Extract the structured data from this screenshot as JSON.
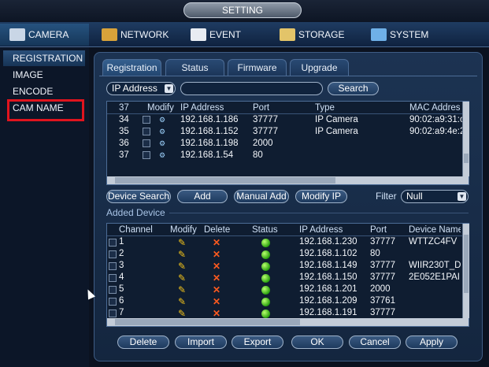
{
  "title": "SETTING",
  "main_tabs": [
    {
      "label": "CAMERA",
      "icon": "camera-icon"
    },
    {
      "label": "NETWORK",
      "icon": "network-icon"
    },
    {
      "label": "EVENT",
      "icon": "event-icon"
    },
    {
      "label": "STORAGE",
      "icon": "storage-icon"
    },
    {
      "label": "SYSTEM",
      "icon": "system-icon"
    }
  ],
  "left_menu": [
    {
      "label": "REGISTRATION",
      "active": true
    },
    {
      "label": "IMAGE"
    },
    {
      "label": "ENCODE"
    },
    {
      "label": "CAM NAME",
      "highlighted": true
    }
  ],
  "sub_tabs": [
    "Registration",
    "Status",
    "Firmware",
    "Upgrade"
  ],
  "search": {
    "type_value": "IP Address",
    "input_value": "",
    "button": "Search"
  },
  "found_table": {
    "headers": {
      "count": "37",
      "modify": "Modify",
      "ip": "IP Address",
      "port": "Port",
      "type": "Type",
      "mac": "MAC Addres"
    },
    "rows": [
      {
        "num": "34",
        "ip": "192.168.1.186",
        "port": "37777",
        "type": "IP Camera",
        "mac": "90:02:a9:31:c"
      },
      {
        "num": "35",
        "ip": "192.168.1.152",
        "port": "37777",
        "type": "IP Camera",
        "mac": "90:02:a9:4e:2"
      },
      {
        "num": "36",
        "ip": "192.168.1.198",
        "port": "2000",
        "type": "",
        "mac": ""
      },
      {
        "num": "37",
        "ip": "192.168.1.54",
        "port": "80",
        "type": "",
        "mac": ""
      }
    ]
  },
  "actions": {
    "device_search": "Device Search",
    "add": "Add",
    "manual_add": "Manual Add",
    "modify_ip": "Modify IP"
  },
  "filter": {
    "label": "Filter",
    "value": "Null"
  },
  "added_device": {
    "label": "Added Device",
    "headers": {
      "channel": "Channel",
      "modify": "Modify",
      "delete": "Delete",
      "status": "Status",
      "ip": "IP Address",
      "port": "Port",
      "name": "Device Name"
    },
    "rows": [
      {
        "channel": "1",
        "ip": "192.168.1.230",
        "port": "37777",
        "name": "WTTZC4FV"
      },
      {
        "channel": "2",
        "ip": "192.168.1.102",
        "port": "80",
        "name": ""
      },
      {
        "channel": "3",
        "ip": "192.168.1.149",
        "port": "37777",
        "name": "WIIR230T_D"
      },
      {
        "channel": "4",
        "ip": "192.168.1.150",
        "port": "37777",
        "name": "2E052E1PAI"
      },
      {
        "channel": "5",
        "ip": "192.168.1.201",
        "port": "2000",
        "name": ""
      },
      {
        "channel": "6",
        "ip": "192.168.1.209",
        "port": "37761",
        "name": ""
      },
      {
        "channel": "7",
        "ip": "192.168.1.191",
        "port": "37777",
        "name": ""
      }
    ]
  },
  "footer": {
    "delete": "Delete",
    "import": "Import",
    "export": "Export",
    "ok": "OK",
    "cancel": "Cancel",
    "apply": "Apply"
  },
  "colors": {
    "highlight_box": "#e0141e",
    "status_ok": "#2aa10e",
    "modify": "#f2c21a",
    "delete": "#ff5a1f"
  }
}
